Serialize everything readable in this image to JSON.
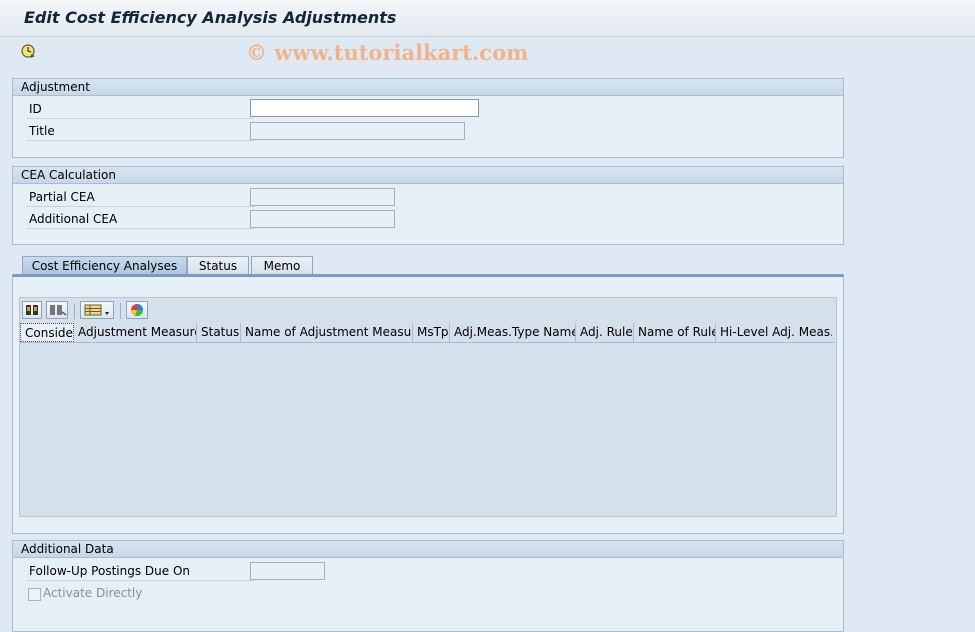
{
  "window": {
    "title": "Edit Cost Efficiency Analysis Adjustments"
  },
  "watermark": "© www.tutorialkart.com",
  "adjustment": {
    "heading": "Adjustment",
    "id_label": "ID",
    "id_value": "",
    "title_label": "Title",
    "title_value": ""
  },
  "cea": {
    "heading": "CEA Calculation",
    "partial_label": "Partial CEA",
    "partial_value": "",
    "additional_label": "Additional CEA",
    "additional_value": ""
  },
  "tabs": [
    {
      "label": "Cost Efficiency Analyses",
      "active": true
    },
    {
      "label": "Status",
      "active": false
    },
    {
      "label": "Memo",
      "active": false
    }
  ],
  "table": {
    "columns": [
      "Consider",
      "Adjustment Measure",
      "Status",
      "Name of Adjustment Measure",
      "MsTp",
      "Adj.Meas.Type Name",
      "Adj. Rule",
      "Name of Rule",
      "Hi-Level Adj. Meas."
    ],
    "rows": []
  },
  "additional": {
    "heading": "Additional Data",
    "followup_label": "Follow-Up Postings Due On",
    "followup_value": "",
    "activate_label": "Activate Directly",
    "activate_checked": false
  },
  "icons": {
    "toolbar": "execute-clock-icon",
    "alv": [
      "details-icon",
      "find-icon",
      "layout-icon",
      "graphic-icon"
    ]
  }
}
